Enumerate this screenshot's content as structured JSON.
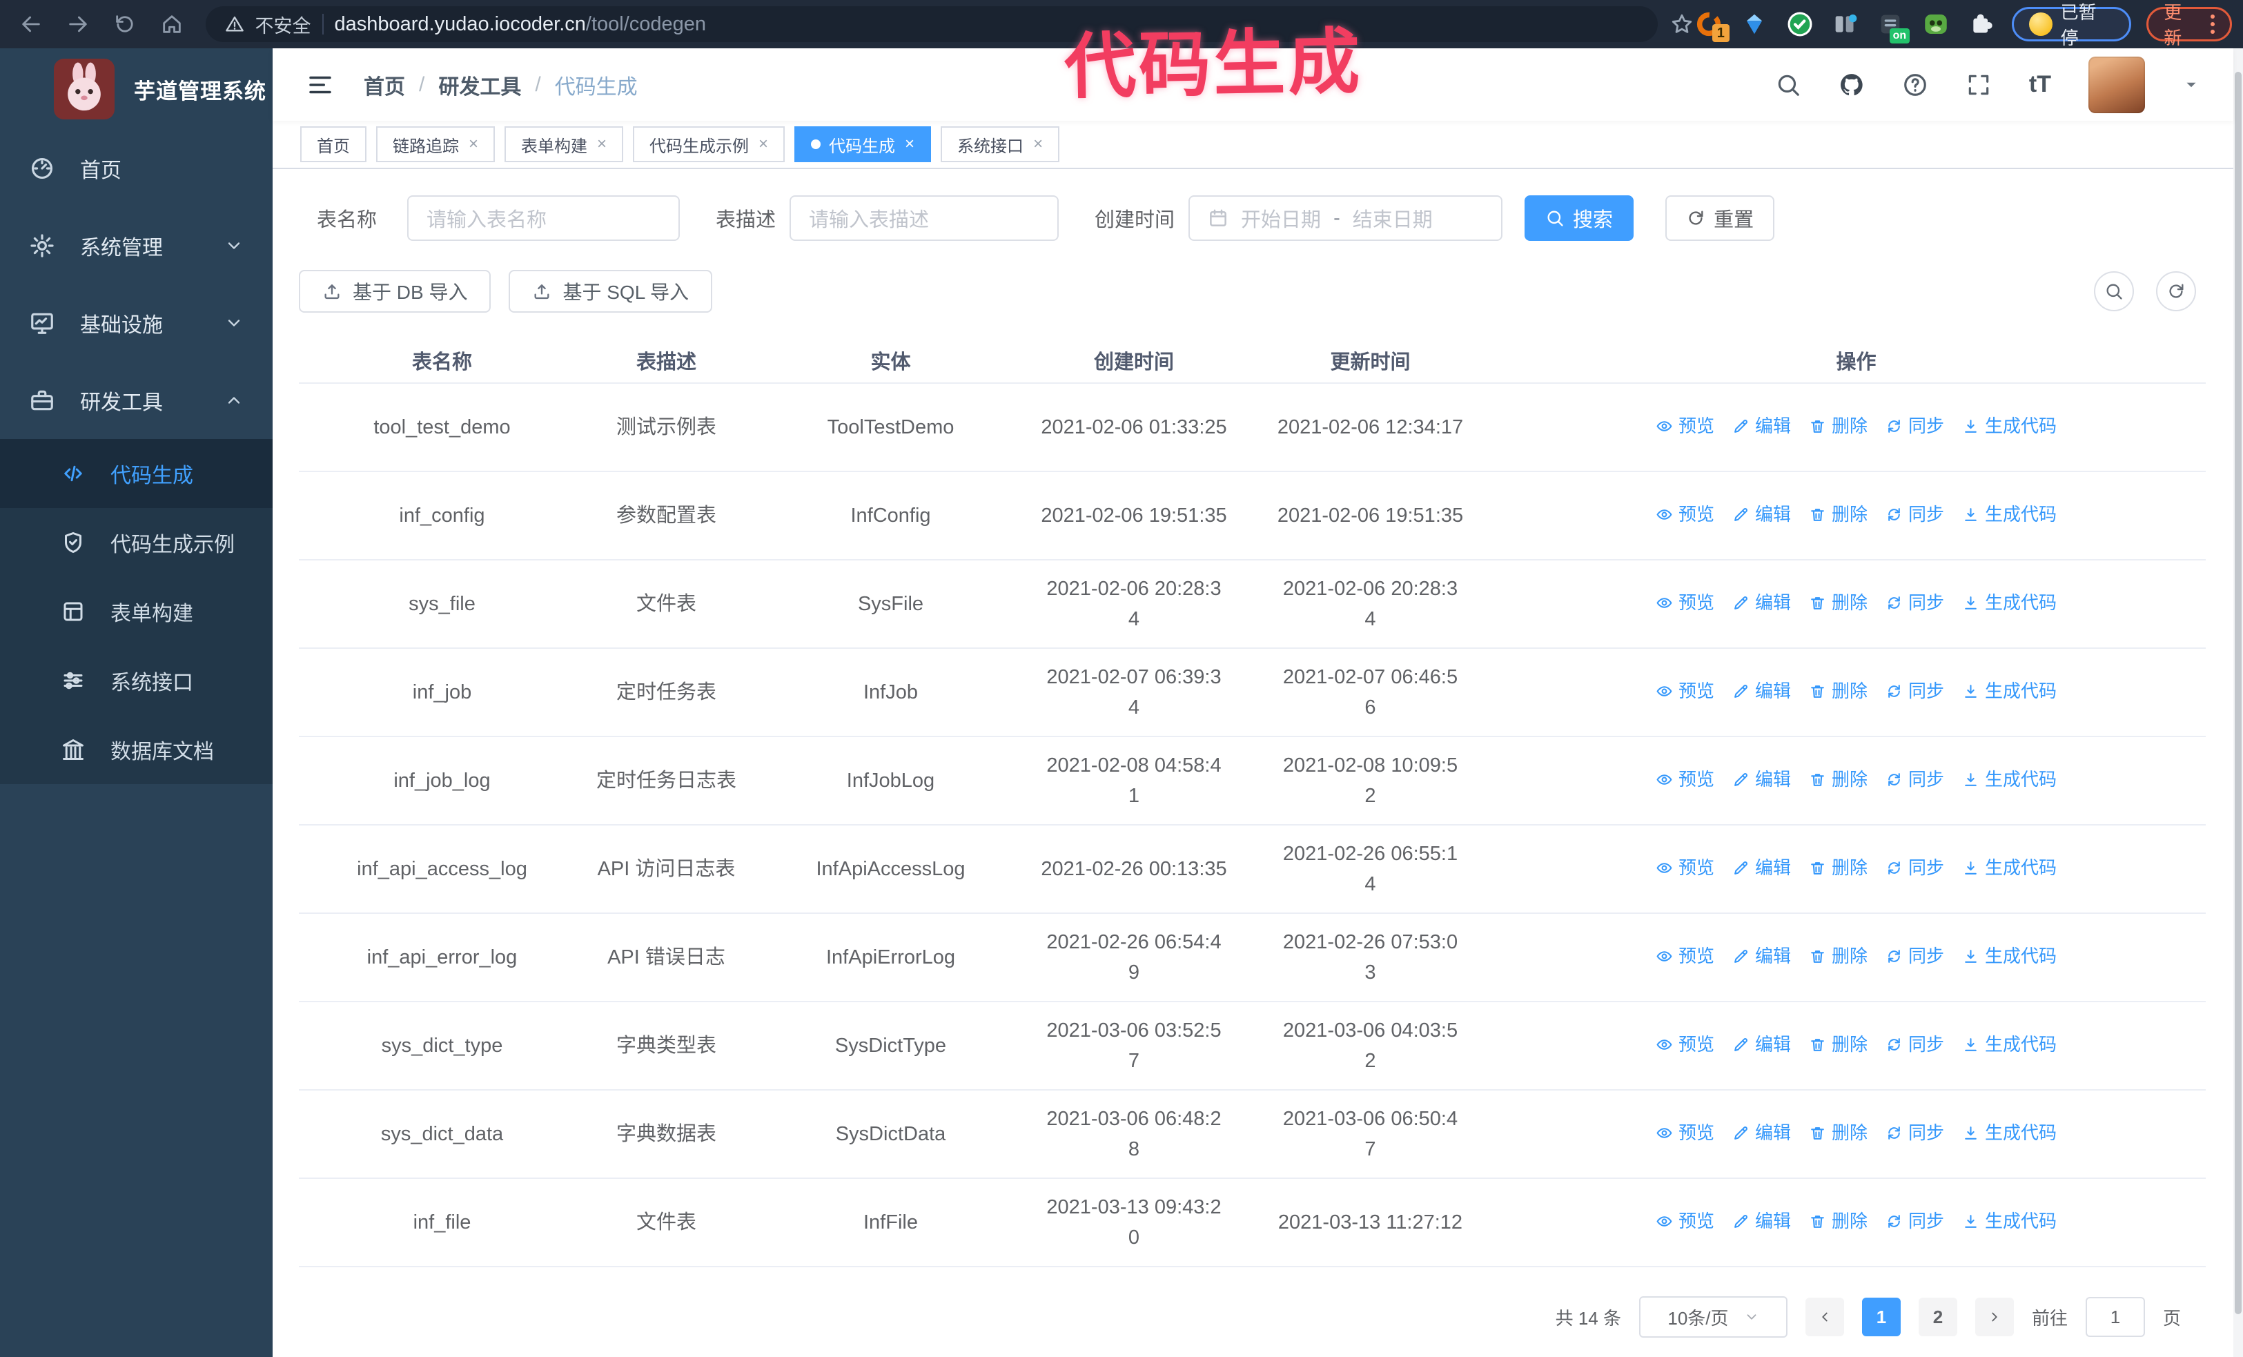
{
  "browser": {
    "security_warning": "不安全",
    "url_domain": "dashboard.yudao.iocoder.cn",
    "url_path": "/tool/codegen",
    "ext_badge": "1",
    "on_badge": "on",
    "paused_label": "已暂停",
    "update_label": "更新"
  },
  "annotation": {
    "text": "代码生成",
    "color": "#f23d60"
  },
  "sidebar": {
    "title": "芋道管理系统",
    "items": [
      {
        "label": "首页",
        "icon": "dashboard-icon"
      },
      {
        "label": "系统管理",
        "icon": "gear-icon",
        "chevron": "down"
      },
      {
        "label": "基础设施",
        "icon": "monitor-icon",
        "chevron": "down"
      },
      {
        "label": "研发工具",
        "icon": "toolbox-icon",
        "chevron": "up"
      }
    ],
    "subitems": [
      {
        "label": "代码生成",
        "icon": "code-icon",
        "active": true
      },
      {
        "label": "代码生成示例",
        "icon": "shield-check-icon"
      },
      {
        "label": "表单构建",
        "icon": "form-icon"
      },
      {
        "label": "系统接口",
        "icon": "sliders-icon"
      },
      {
        "label": "数据库文档",
        "icon": "columns-icon"
      }
    ]
  },
  "header": {
    "breadcrumb": [
      "首页",
      "研发工具",
      "代码生成"
    ]
  },
  "tabs": [
    {
      "label": "首页",
      "closable": false,
      "active": false
    },
    {
      "label": "链路追踪",
      "closable": true,
      "active": false
    },
    {
      "label": "表单构建",
      "closable": true,
      "active": false
    },
    {
      "label": "代码生成示例",
      "closable": true,
      "active": false
    },
    {
      "label": "代码生成",
      "closable": true,
      "active": true
    },
    {
      "label": "系统接口",
      "closable": true,
      "active": false
    }
  ],
  "filters": {
    "name_label": "表名称",
    "name_placeholder": "请输入表名称",
    "desc_label": "表描述",
    "desc_placeholder": "请输入表描述",
    "time_label": "创建时间",
    "start_placeholder": "开始日期",
    "range_separator": "-",
    "end_placeholder": "结束日期",
    "search_button": "搜索",
    "reset_button": "重置"
  },
  "toolbar": {
    "import_db": "基于 DB 导入",
    "import_sql": "基于 SQL 导入"
  },
  "table": {
    "columns": [
      "表名称",
      "表描述",
      "实体",
      "创建时间",
      "更新时间",
      "操作"
    ],
    "actions": [
      "预览",
      "编辑",
      "删除",
      "同步",
      "生成代码"
    ],
    "action_icons": [
      "eye-icon",
      "pencil-icon",
      "trash-icon",
      "sync-icon",
      "download-icon"
    ],
    "rows": [
      {
        "name": "tool_test_demo",
        "desc": "测试示例表",
        "entity": "ToolTestDemo",
        "created": "2021-02-06 01:33:25",
        "updated": "2021-02-06 12:34:17"
      },
      {
        "name": "inf_config",
        "desc": "参数配置表",
        "entity": "InfConfig",
        "created": "2021-02-06 19:51:35",
        "updated": "2021-02-06 19:51:35"
      },
      {
        "name": "sys_file",
        "desc": "文件表",
        "entity": "SysFile",
        "created": "2021-02-06 20:28:3\n4",
        "updated": "2021-02-06 20:28:3\n4"
      },
      {
        "name": "inf_job",
        "desc": "定时任务表",
        "entity": "InfJob",
        "created": "2021-02-07 06:39:3\n4",
        "updated": "2021-02-07 06:46:5\n6"
      },
      {
        "name": "inf_job_log",
        "desc": "定时任务日志表",
        "entity": "InfJobLog",
        "created": "2021-02-08 04:58:4\n1",
        "updated": "2021-02-08 10:09:5\n2"
      },
      {
        "name": "inf_api_access_log",
        "desc": "API 访问日志表",
        "entity": "InfApiAccessLog",
        "created": "2021-02-26 00:13:35",
        "updated": "2021-02-26 06:55:1\n4"
      },
      {
        "name": "inf_api_error_log",
        "desc": "API 错误日志",
        "entity": "InfApiErrorLog",
        "created": "2021-02-26 06:54:4\n9",
        "updated": "2021-02-26 07:53:0\n3"
      },
      {
        "name": "sys_dict_type",
        "desc": "字典类型表",
        "entity": "SysDictType",
        "created": "2021-03-06 03:52:5\n7",
        "updated": "2021-03-06 04:03:5\n2"
      },
      {
        "name": "sys_dict_data",
        "desc": "字典数据表",
        "entity": "SysDictData",
        "created": "2021-03-06 06:48:2\n8",
        "updated": "2021-03-06 06:50:4\n7"
      },
      {
        "name": "inf_file",
        "desc": "文件表",
        "entity": "InfFile",
        "created": "2021-03-13 09:43:2\n0",
        "updated": "2021-03-13 11:27:12"
      }
    ]
  },
  "pagination": {
    "total": "共 14 条",
    "page_size": "10条/页",
    "pages": [
      "1",
      "2"
    ],
    "active_page": "1",
    "goto_label": "前往",
    "goto_value": "1",
    "goto_suffix": "页"
  },
  "colors": {
    "accent": "#409eff",
    "sidebar_bg": "#2a4257",
    "submenu_bg": "#223749",
    "browser_bg": "#212b3a",
    "annotation": "#f23d60"
  }
}
